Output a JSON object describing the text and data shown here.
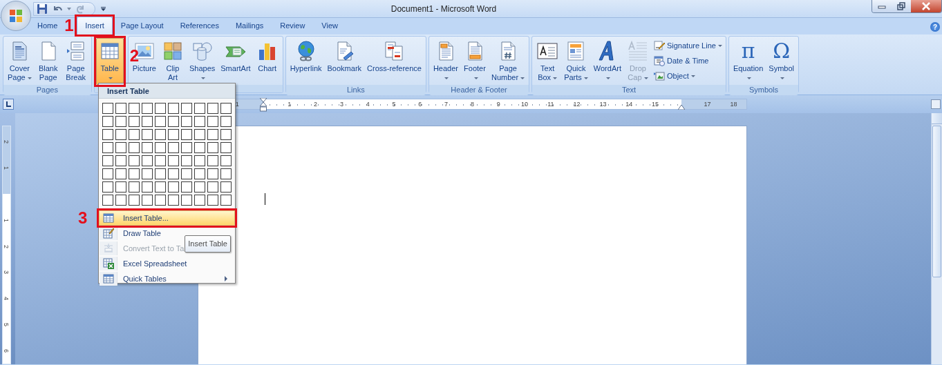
{
  "window": {
    "title": "Document1 - Microsoft Word"
  },
  "help": {
    "glyph": "?"
  },
  "tabs": [
    {
      "label": "Home",
      "selected": false
    },
    {
      "label": "Insert",
      "selected": true,
      "callout": "1"
    },
    {
      "label": "Page Layout",
      "selected": false
    },
    {
      "label": "References",
      "selected": false
    },
    {
      "label": "Mailings",
      "selected": false
    },
    {
      "label": "Review",
      "selected": false
    },
    {
      "label": "View",
      "selected": false
    }
  ],
  "ribbon_groups": [
    {
      "label": "Pages",
      "items": [
        {
          "kind": "large",
          "lines": [
            "Cover",
            "Page"
          ],
          "dropdown": true,
          "pressed": false,
          "disabled": false
        },
        {
          "kind": "large",
          "lines": [
            "Blank",
            "Page"
          ],
          "dropdown": false,
          "pressed": false,
          "disabled": false
        },
        {
          "kind": "large",
          "lines": [
            "Page",
            "Break"
          ],
          "dropdown": false,
          "pressed": false,
          "disabled": false
        }
      ]
    },
    {
      "items": [
        {
          "kind": "large",
          "lines": [
            "Table"
          ],
          "dropdown": true,
          "pressed": true,
          "disabled": false,
          "callout": "2"
        }
      ]
    },
    {
      "items": [
        {
          "kind": "large",
          "lines": [
            "Picture"
          ],
          "dropdown": false,
          "pressed": false,
          "disabled": false
        },
        {
          "kind": "large",
          "lines": [
            "Clip",
            "Art"
          ],
          "dropdown": false,
          "pressed": false,
          "disabled": false
        },
        {
          "kind": "large",
          "lines": [
            "Shapes"
          ],
          "dropdown": true,
          "pressed": false,
          "disabled": false
        },
        {
          "kind": "large",
          "lines": [
            "SmartArt"
          ],
          "dropdown": false,
          "pressed": false,
          "disabled": false
        },
        {
          "kind": "large",
          "lines": [
            "Chart"
          ],
          "dropdown": false,
          "pressed": false,
          "disabled": false
        }
      ]
    },
    {
      "label": "Links",
      "items": [
        {
          "kind": "large",
          "lines": [
            "Hyperlink"
          ],
          "dropdown": false,
          "pressed": false,
          "disabled": false
        },
        {
          "kind": "large",
          "lines": [
            "Bookmark"
          ],
          "dropdown": false,
          "pressed": false,
          "disabled": false
        },
        {
          "kind": "large",
          "lines": [
            "Cross-reference"
          ],
          "dropdown": false,
          "pressed": false,
          "disabled": false
        }
      ]
    },
    {
      "label": "Header & Footer",
      "items": [
        {
          "kind": "large",
          "lines": [
            "Header"
          ],
          "dropdown": true,
          "pressed": false,
          "disabled": false
        },
        {
          "kind": "large",
          "lines": [
            "Footer"
          ],
          "dropdown": true,
          "pressed": false,
          "disabled": false
        },
        {
          "kind": "large",
          "lines": [
            "Page",
            "Number"
          ],
          "dropdown": true,
          "pressed": false,
          "disabled": false
        }
      ]
    },
    {
      "label": "Text",
      "items": [
        {
          "kind": "large",
          "lines": [
            "Text",
            "Box"
          ],
          "dropdown": true,
          "pressed": false,
          "disabled": false
        },
        {
          "kind": "large",
          "lines": [
            "Quick",
            "Parts"
          ],
          "dropdown": true,
          "pressed": false,
          "disabled": false
        },
        {
          "kind": "large",
          "lines": [
            "WordArt"
          ],
          "dropdown": true,
          "pressed": false,
          "disabled": false
        },
        {
          "kind": "large",
          "lines": [
            "Drop",
            "Cap"
          ],
          "dropdown": true,
          "pressed": false,
          "disabled": true
        },
        {
          "kind": "small",
          "label": "Signature Line",
          "dropdown": true,
          "pressed": false,
          "disabled": false
        },
        {
          "kind": "small",
          "label": "Date & Time",
          "dropdown": false,
          "pressed": false,
          "disabled": false
        },
        {
          "kind": "small",
          "label": "Object",
          "dropdown": true,
          "pressed": false,
          "disabled": false
        }
      ]
    },
    {
      "label": "Symbols",
      "items": [
        {
          "kind": "large",
          "glyph": "π",
          "lines": [
            "Equation"
          ],
          "dropdown": true,
          "pressed": false,
          "disabled": false
        },
        {
          "kind": "large",
          "glyph": "Ω",
          "lines": [
            "Symbol"
          ],
          "dropdown": true,
          "pressed": false,
          "disabled": false
        }
      ]
    }
  ],
  "horizontal_ruler": {
    "labels": [
      "1",
      "1",
      "2",
      "3",
      "4",
      "5",
      "6",
      "7",
      "8",
      "9",
      "10",
      "11",
      "12",
      "13",
      "14",
      "15",
      "17",
      "18"
    ]
  },
  "vertical_ruler": {
    "labels": [
      "2",
      "1",
      "1",
      "2",
      "3",
      "4",
      "5",
      "6"
    ]
  },
  "table_menu": {
    "title": "Insert Table",
    "items": [
      {
        "label": "Insert Table...",
        "selected": true,
        "disabled": false,
        "submenu": false,
        "callout": "3"
      },
      {
        "label": "Draw Table",
        "selected": false,
        "disabled": false,
        "submenu": false
      },
      {
        "label": "Convert Text to Ta",
        "selected": false,
        "disabled": true,
        "submenu": false
      },
      {
        "label": "Excel Spreadsheet",
        "selected": false,
        "disabled": false,
        "submenu": false
      },
      {
        "label": "Quick Tables",
        "selected": false,
        "disabled": false,
        "submenu": true
      }
    ]
  },
  "tooltip": {
    "text": "Insert Table"
  }
}
